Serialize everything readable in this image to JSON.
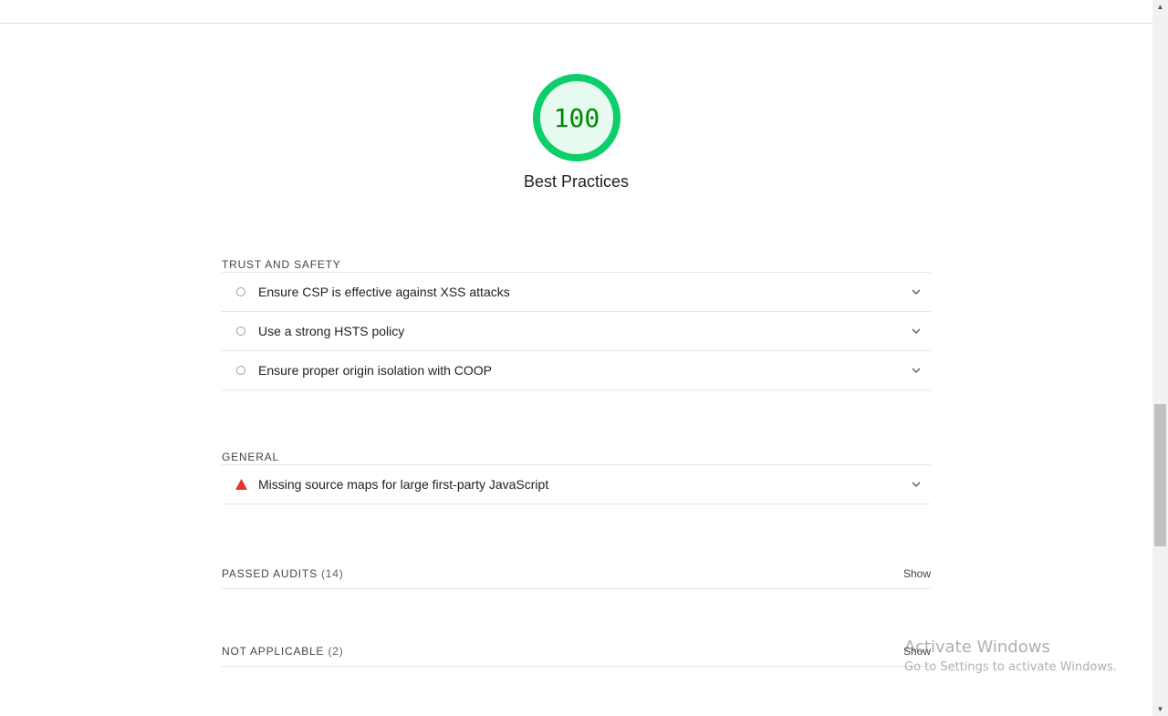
{
  "score": {
    "value": "100",
    "fraction": 1.0,
    "ring_color": "#0cce6b",
    "fill_color": "#e6faf0",
    "text_color": "#008800",
    "title": "Best Practices"
  },
  "groups": {
    "trust": {
      "title": "TRUST AND SAFETY",
      "audits": [
        {
          "label": "Ensure CSP is effective against XSS attacks",
          "icon": "informative-circle-icon"
        },
        {
          "label": "Use a strong HSTS policy",
          "icon": "informative-circle-icon"
        },
        {
          "label": "Ensure proper origin isolation with COOP",
          "icon": "informative-circle-icon"
        }
      ]
    },
    "general": {
      "title": "GENERAL",
      "audits": [
        {
          "label": "Missing source maps for large first-party JavaScript",
          "icon": "warning-triangle-icon",
          "color": "#eb3223"
        }
      ]
    }
  },
  "passed": {
    "title": "PASSED AUDITS",
    "count": "(14)",
    "toggle": "Show"
  },
  "not_applicable": {
    "title": "NOT APPLICABLE",
    "count": "(2)",
    "toggle": "Show"
  },
  "watermark": {
    "title": "Activate Windows",
    "subtitle": "Go to Settings to activate Windows."
  }
}
